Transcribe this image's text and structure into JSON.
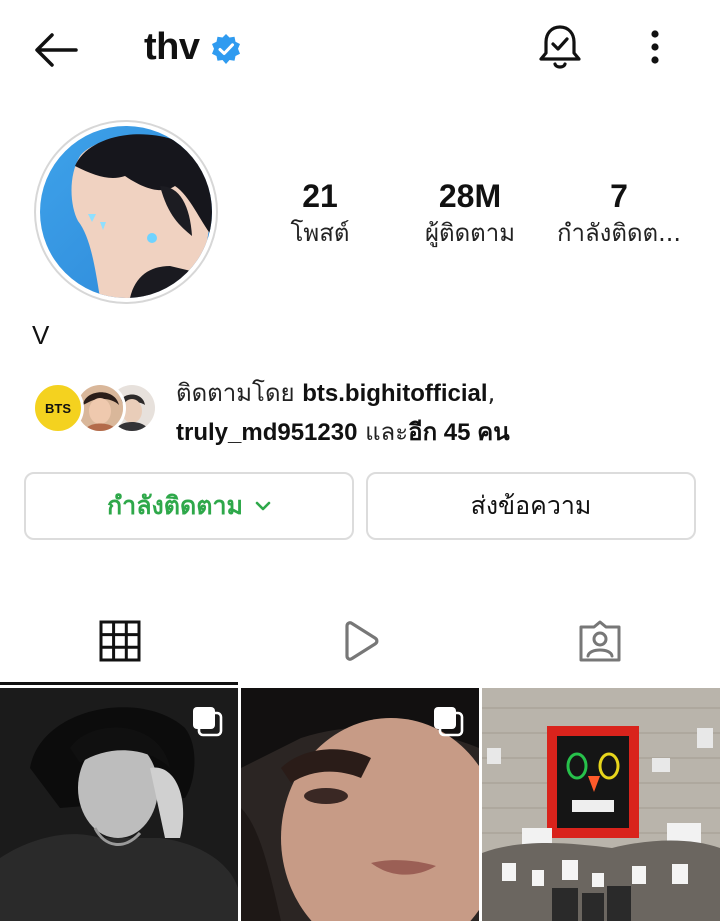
{
  "header": {
    "username": "thv",
    "back_icon": "arrow-left-icon",
    "verified_icon": "verified-badge-icon",
    "bell_icon": "bell-check-icon",
    "more_icon": "more-vertical-icon"
  },
  "stats": [
    {
      "value": "21",
      "label": "โพสต์"
    },
    {
      "value": "28M",
      "label": "ผู้ติดตาม"
    },
    {
      "value": "7",
      "label": "กำลังติดต..."
    }
  ],
  "bio": {
    "name": "V"
  },
  "followed_by": {
    "prefix": "ติดตามโดย ",
    "user1": "bts.bighitofficial",
    "sep": ",",
    "user2": "truly_md951230",
    "and": " และ",
    "others": "อีก 45 คน",
    "avatars": [
      {
        "name": "bts-avatar",
        "text": "BTS"
      },
      {
        "name": "user-avatar-2"
      },
      {
        "name": "user-avatar-3"
      }
    ]
  },
  "actions": {
    "following_label": "กำลังติดตาม",
    "message_label": "ส่งข้อความ"
  },
  "tabs": [
    {
      "name": "grid-icon",
      "active": true
    },
    {
      "name": "reels-icon",
      "active": false
    },
    {
      "name": "tagged-icon",
      "active": false
    }
  ],
  "colors": {
    "accent_green": "#2ea84a",
    "verified_blue": "#2f9bf0",
    "bts_yellow": "#f4d21f"
  }
}
